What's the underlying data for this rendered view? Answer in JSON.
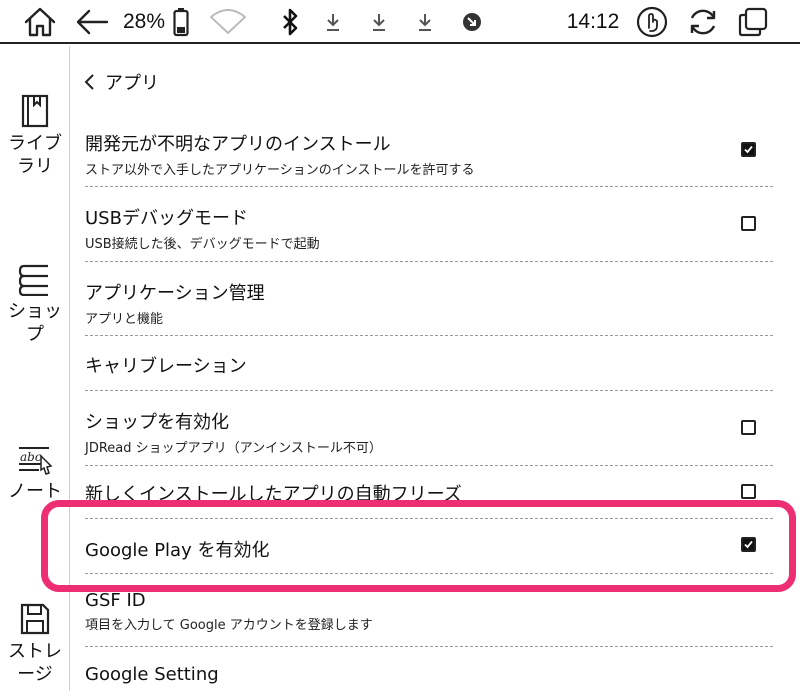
{
  "status_bar": {
    "battery_percent": "28%",
    "time": "14:12",
    "icons": [
      "home-icon",
      "back-arrow-icon",
      "battery-icon",
      "wifi-icon",
      "bluetooth-icon",
      "download-icon",
      "download-icon",
      "download-icon",
      "notification-icon",
      "touch-icon",
      "refresh-icon",
      "window-switch-icon"
    ]
  },
  "sidebar": {
    "items": [
      {
        "label": "ライブラリ",
        "icon": "book-icon"
      },
      {
        "label": "ショップ",
        "icon": "shop-icon"
      },
      {
        "label": "ノート",
        "icon": "note-icon"
      },
      {
        "label": "ストレージ",
        "icon": "storage-icon"
      }
    ]
  },
  "header": {
    "back_label": "アプリ"
  },
  "settings": [
    {
      "title": "開発元が不明なアプリのインストール",
      "subtitle": "ストア以外で入手したアプリケーションのインストールを許可する",
      "checked": true
    },
    {
      "title": "USBデバッグモード",
      "subtitle": "USB接続した後、デバッグモードで起動",
      "checked": false
    },
    {
      "title": "アプリケーション管理",
      "subtitle": "アプリと機能"
    },
    {
      "title": "キャリブレーション"
    },
    {
      "title": "ショップを有効化",
      "subtitle": "JDRead ショップアプリ（アンインストール不可）",
      "checked": false
    },
    {
      "title": "新しくインストールしたアプリの自動フリーズ",
      "checked": false
    },
    {
      "title": "Google Play を有効化",
      "checked": true,
      "highlighted": true
    },
    {
      "title": "GSF ID",
      "subtitle": "項目を入力して Google アカウントを登録します"
    },
    {
      "title": "Google Setting"
    }
  ],
  "colors": {
    "highlight": "#ee2e72",
    "text": "#111111",
    "divider": "#9a9a9a"
  }
}
